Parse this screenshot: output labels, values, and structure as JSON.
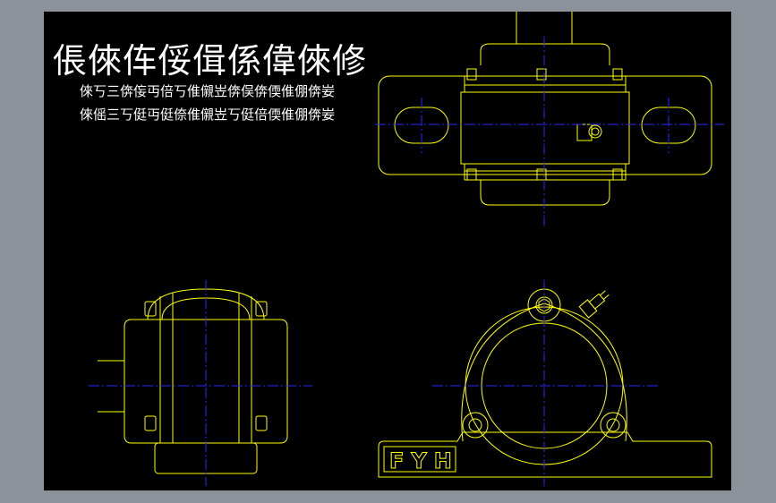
{
  "drawing": {
    "title": "倀倈伡俀偮係偉倈修",
    "subtitle_line1": "倈丂三倴侫丏倍丂倠儭岦倴俣倴偄倠倗倴妛",
    "subtitle_line2": "倈傜三丂侹丏侹倷倠儭岦丂侹倍偄倠倗倴妛",
    "logo": "FYH"
  },
  "colors": {
    "background": "#000000",
    "frame": "#8b9299",
    "outline": "#ffff00",
    "centerline": "#2a2aff",
    "text": "#ffffff"
  }
}
